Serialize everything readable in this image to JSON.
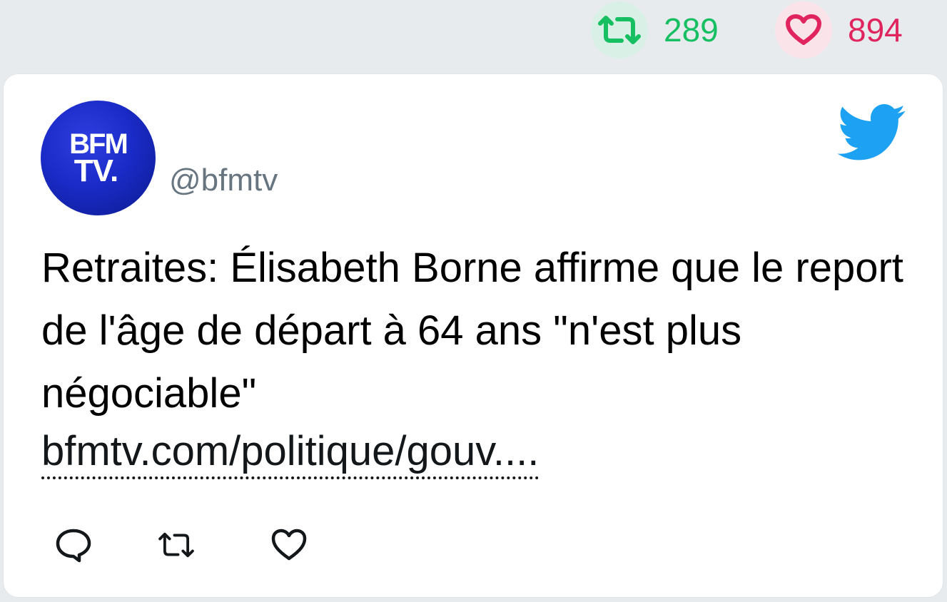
{
  "stats": {
    "retweets": "289",
    "likes": "894"
  },
  "tweet": {
    "avatar_line1": "BFM",
    "avatar_line2": "TV.",
    "handle": "@bfmtv",
    "text": "Retraites: Élisabeth Borne affirme que le report de l'âge de départ à 64 ans \"n'est plus négociable\"",
    "link": "bfmtv.com/politique/gouv...."
  },
  "icons": {
    "brand": "twitter-bird-icon",
    "reply": "reply-icon",
    "retweet": "retweet-icon",
    "like": "heart-icon"
  },
  "colors": {
    "retweet": "#17bf63",
    "like": "#e0245e",
    "twitter_blue": "#1da1f2",
    "handle": "#66757f"
  }
}
